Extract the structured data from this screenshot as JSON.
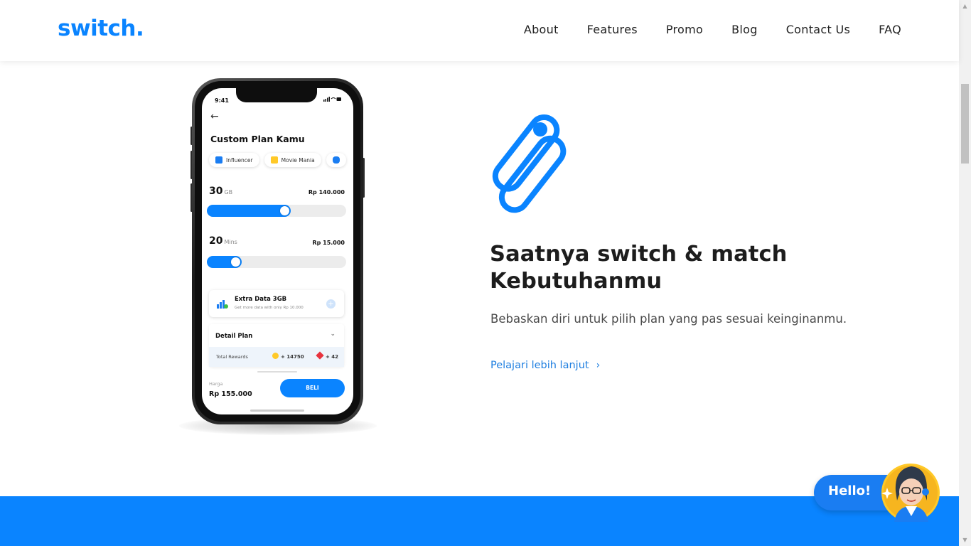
{
  "header": {
    "logo": "switch.",
    "nav": [
      "About",
      "Features",
      "Promo",
      "Blog",
      "Contact Us",
      "FAQ"
    ]
  },
  "phone": {
    "time": "9:41",
    "status_icons": "signal wifi battery",
    "title": "Custom Plan Kamu",
    "chips": [
      "Influencer",
      "Movie Mania"
    ],
    "data_plan": {
      "amount": "30",
      "unit": "GB",
      "price": "Rp 140.000",
      "fill": 0.6
    },
    "mins_plan": {
      "amount": "20",
      "unit": "Mins",
      "price": "Rp 15.000",
      "fill": 0.25
    },
    "extra": {
      "title": "Extra Data 3GB",
      "subtitle": "Get more data with only Rp 10.000"
    },
    "detail": {
      "title": "Detail Plan",
      "rewards_label": "Total Rewards",
      "coin_value": "+ 14750",
      "gem_value": "+ 42"
    },
    "harga_label": "Harga",
    "harga_price": "Rp 155.000",
    "buy_label": "BELI"
  },
  "hero": {
    "headline_line1": "Saatnya switch & match",
    "headline_line2": "Kebutuhanmu",
    "subtext": "Bebaskan diri untuk pilih plan yang pas sesuai keinginanmu.",
    "link": "Pelajari lebih lanjut"
  },
  "chat": {
    "label": "Hello!"
  },
  "colors": {
    "brand_blue": "#0a84ff",
    "link_blue": "#1f7fe0",
    "text_dark": "#1d1d1d"
  },
  "icons": [
    "arrow-left-icon",
    "chevron-down-icon",
    "chevron-right-icon",
    "plus-icon",
    "coin-icon",
    "gem-icon",
    "signal-bars-icon",
    "switch-brand-mark"
  ]
}
